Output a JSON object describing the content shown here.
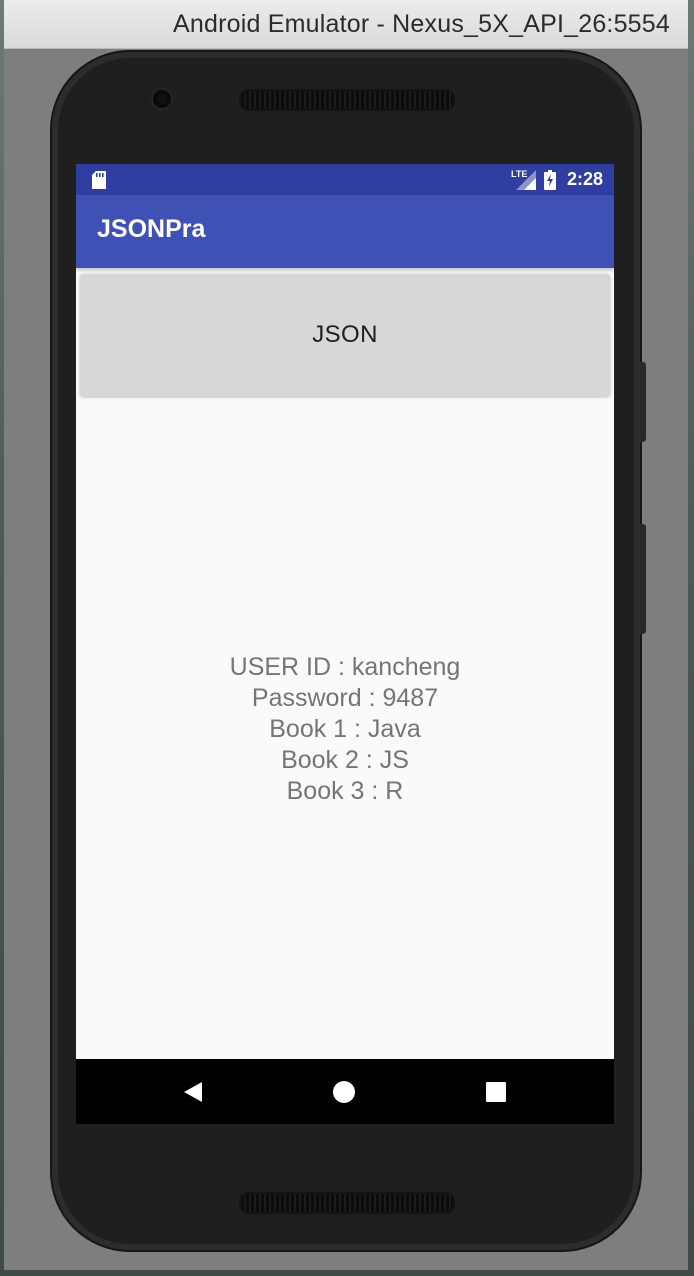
{
  "window": {
    "title": "Android Emulator - Nexus_5X_API_26:5554"
  },
  "status_bar": {
    "network_label": "LTE",
    "time": "2:28",
    "icons": [
      "sd-card-icon",
      "cell-signal-icon",
      "battery-charging-icon"
    ]
  },
  "app_bar": {
    "title": "JSONPra"
  },
  "main": {
    "json_button_label": "JSON",
    "result_lines": [
      "USER ID : kancheng",
      "Password : 9487",
      "Book 1 : Java",
      "Book 2 : JS",
      "Book 3 : R"
    ]
  },
  "nav_bar": {
    "buttons": [
      "back-icon",
      "home-icon",
      "recents-icon"
    ]
  },
  "colors": {
    "status_bar": "#2f3ea0",
    "app_bar": "#3f51b5",
    "button_bg": "#d6d7d7",
    "result_text": "#757575",
    "screen_bg": "#fafafa"
  }
}
